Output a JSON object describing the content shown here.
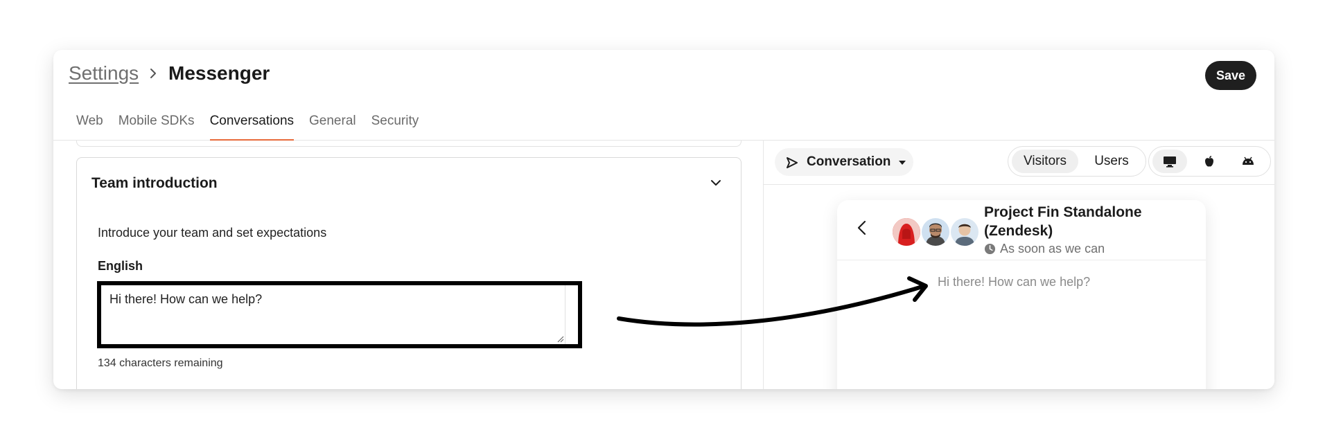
{
  "breadcrumb": {
    "parent": "Settings",
    "current": "Messenger"
  },
  "header": {
    "save_label": "Save"
  },
  "tabs": [
    {
      "label": "Web",
      "active": false
    },
    {
      "label": "Mobile SDKs",
      "active": false
    },
    {
      "label": "Conversations",
      "active": true
    },
    {
      "label": "General",
      "active": false
    },
    {
      "label": "Security",
      "active": false
    }
  ],
  "team_intro": {
    "title": "Team introduction",
    "description": "Introduce your team and set expectations",
    "language_label": "English",
    "textarea_value": "Hi there! How can we help?",
    "remaining": "134 characters remaining"
  },
  "preview_toolbar": {
    "mode_label": "Conversation",
    "audience": [
      "Visitors",
      "Users"
    ],
    "audience_selected": "Visitors",
    "devices": [
      "desktop-icon",
      "apple-icon",
      "android-icon"
    ],
    "device_selected": "desktop-icon"
  },
  "preview": {
    "title": "Project Fin Standalone (Zendesk)",
    "response_time": "As soon as we can",
    "greeting": "Hi there! How can we help?"
  },
  "colors": {
    "accent": "#e86a3a",
    "save_bg": "#1f1f1f"
  }
}
